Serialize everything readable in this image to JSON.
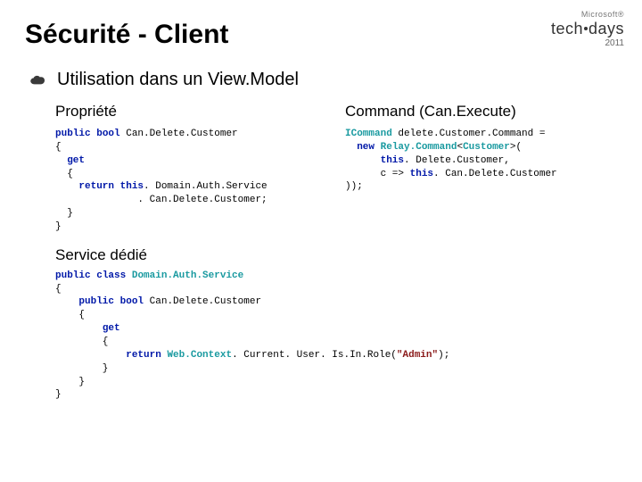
{
  "logo": {
    "vendor": "Microsoft®",
    "year": "2011"
  },
  "title": "Sécurité - Client",
  "bullet": "Utilisation dans un View.Model",
  "headings": {
    "property": "Propriété",
    "command": "Command (Can.Execute)",
    "service": "Service dédié"
  },
  "code": {
    "kw_public": "public",
    "kw_bool": "bool",
    "kw_get": "get",
    "kw_return": "return",
    "kw_this": "this",
    "kw_new": "new",
    "kw_class": "class",
    "prop_name": "Can.Delete.Customer",
    "prop_body1": ". Domain.Auth.Service",
    "prop_body2": ". Can.Delete.Customer;",
    "t_icommand": "ICommand",
    "t_relay": "Relay.Command",
    "t_customer": "Customer",
    "t_domainauth": "Domain.Auth.Service",
    "t_webcontext": "Web.Context",
    "cmd_var": "delete.Customer.Command =",
    "cmd_arg1": ". Delete.Customer,",
    "cmd_arg2a": "c =>",
    "cmd_arg2b": ". Can.Delete.Customer",
    "svc_chain": ". Current. User. Is.In.Role(",
    "str_admin": "\"Admin\"",
    "svc_close": ");"
  }
}
